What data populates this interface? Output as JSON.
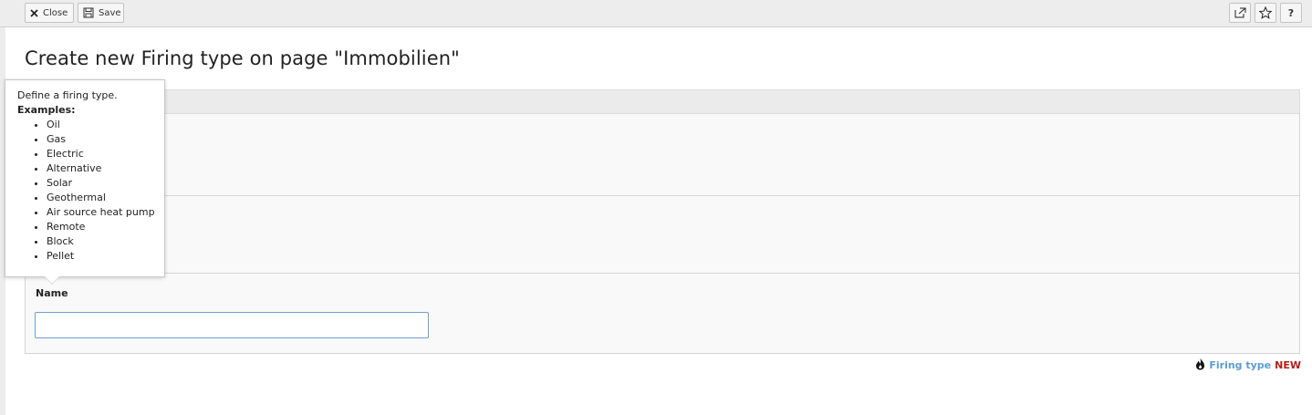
{
  "toolbar": {
    "close_label": "Close",
    "save_label": "Save",
    "close_icon": "close-icon",
    "save_icon": "save-icon",
    "open_external_icon": "open-external-icon",
    "star_icon": "star-icon",
    "help_label": "?"
  },
  "page": {
    "title": "Create new Firing type on page \"Immobilien\""
  },
  "tooltip": {
    "description": "Define a firing type.",
    "examples_label": "Examples:",
    "examples": [
      "Oil",
      "Gas",
      "Electric",
      "Alternative",
      "Solar",
      "Geothermal",
      "Air source heat pump",
      "Remote",
      "Block",
      "Pellet"
    ]
  },
  "form": {
    "name_label": "Name",
    "name_value": "",
    "name_placeholder": ""
  },
  "footer": {
    "icon": "flame-icon",
    "type_label": "Firing type",
    "status_badge": "NEW"
  },
  "colors": {
    "link_blue": "#5b9bd5",
    "new_red": "#b71c1c",
    "input_border": "#6e9fd1"
  }
}
